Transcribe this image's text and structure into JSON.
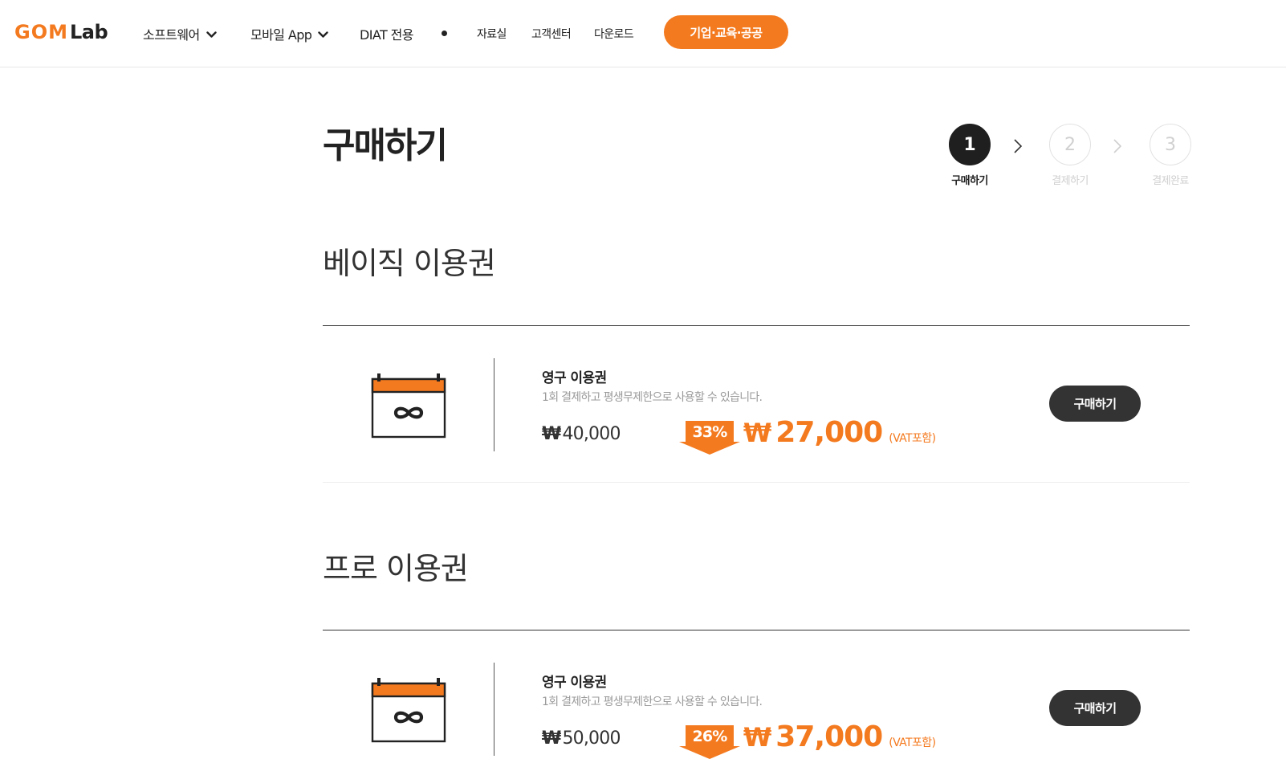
{
  "header": {
    "logo": {
      "gom": "GOM",
      "lab": "Lab"
    },
    "nav": [
      {
        "label": "소프트웨어"
      },
      {
        "label": "모바일 App"
      },
      {
        "label": "DIAT 전용"
      },
      {
        "label": "자료실"
      },
      {
        "label": "고객센터"
      },
      {
        "label": "다운로드"
      }
    ],
    "cta_label": "기업·교육·공공"
  },
  "page": {
    "title": "구매하기",
    "steps": [
      {
        "number": "1",
        "label": "구매하기",
        "active": true
      },
      {
        "number": "2",
        "label": "결제하기",
        "active": false
      },
      {
        "number": "3",
        "label": "결제완료",
        "active": false
      }
    ]
  },
  "sections": [
    {
      "title": "베이직 이용권",
      "product": {
        "name": "영구 이용권",
        "description": "1회 결제하고 평생무제한으로 사용할 수 있습니다.",
        "original_price": "40,000",
        "discount": "33%",
        "price": "27,000",
        "vat_note": "(VAT포함)",
        "buy_label": "구매하기"
      }
    },
    {
      "title": "프로 이용권",
      "product": {
        "name": "영구 이용권",
        "description": "1회 결제하고 평생무제한으로 사용할 수 있습니다.",
        "original_price": "50,000",
        "discount": "26%",
        "price": "37,000",
        "vat_note": "(VAT포함)",
        "buy_label": "구매하기"
      }
    }
  ],
  "currency_symbol": "₩",
  "colors": {
    "accent": "#f47a1f",
    "dark": "#1f1f1f",
    "button": "#333333",
    "muted": "#cfcfcf"
  },
  "icons": [
    "chevron-down-icon",
    "chevron-right-icon",
    "calendar-infinity-icon",
    "down-arrow-badge-icon"
  ]
}
